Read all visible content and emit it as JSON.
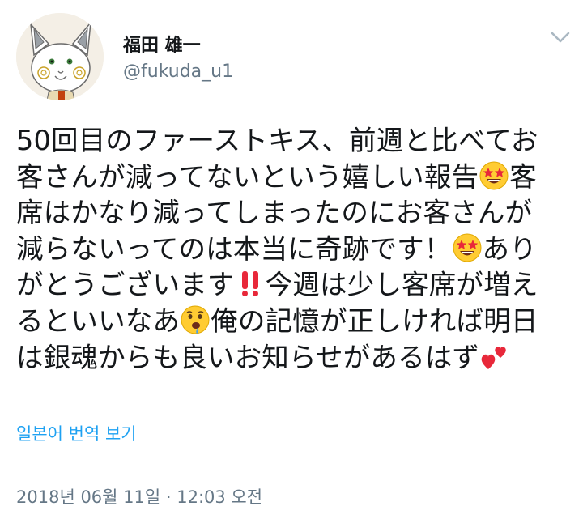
{
  "user": {
    "display_name": "福田 雄一",
    "handle": "@fukuda_u1"
  },
  "tweet": {
    "text_lines": [
      [
        "50回目のファーストキス、前週と比べてお"
      ],
      [
        "客さんが減ってないという嬉しい報告",
        "{star-struck}",
        "客"
      ],
      [
        "席はかなり減ってしまったのにお客さんが"
      ],
      [
        "減らないってのは本当に奇跡です！",
        "{star-struck}",
        "あり"
      ],
      [
        "がとうございます",
        "{double-exclamation}",
        "今週は少し客席が増え"
      ],
      [
        "るといいなあ",
        "{drooling}",
        "俺の記憶が正しければ明日"
      ],
      [
        "は銀魂からも良いお知らせがあるはず",
        "{two-hearts}"
      ]
    ]
  },
  "translate_link": "일본어 번역 보기",
  "timestamp": "2018년 06월 11일 · 12:03 오전",
  "icons": {
    "menu": "chevron-down-icon",
    "emoji": [
      "star-struck-emoji",
      "double-exclamation-emoji",
      "drooling-emoji",
      "two-hearts-emoji"
    ]
  },
  "colors": {
    "text": "#14171a",
    "secondary": "#657786",
    "link": "#1da1f2"
  }
}
